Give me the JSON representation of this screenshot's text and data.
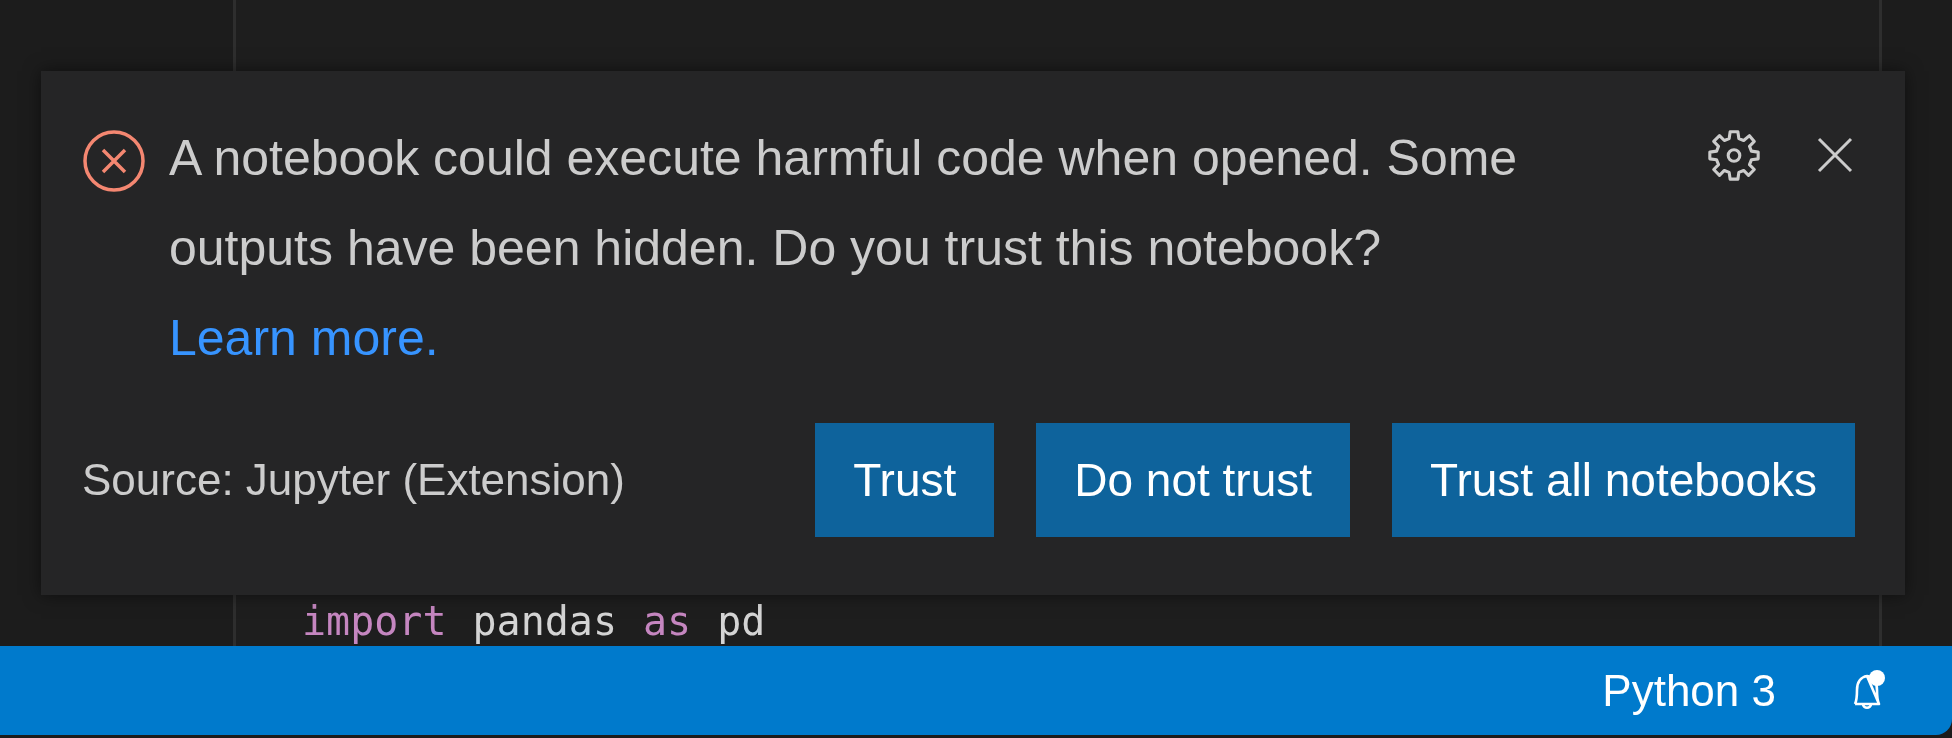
{
  "editor": {
    "code_line": [
      {
        "kind": "keyword",
        "text": "import"
      },
      {
        "kind": "name",
        "text": "pandas"
      },
      {
        "kind": "keyword",
        "text": "as"
      },
      {
        "kind": "name",
        "text": "pd"
      }
    ]
  },
  "notification": {
    "kind": "error",
    "message": "A notebook could execute harmful code when opened. Some outputs have been hidden. Do you trust this notebook?",
    "link": "Learn more.",
    "source": "Source: Jupyter (Extension)",
    "buttons": [
      "Trust",
      "Do not trust",
      "Trust all notebooks"
    ]
  },
  "status_bar": {
    "kernel": "Python 3",
    "unread_notifications": true
  }
}
